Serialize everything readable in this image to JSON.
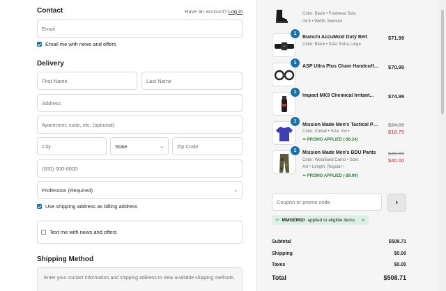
{
  "contact": {
    "heading": "Contact",
    "have_account": "Have an account?",
    "login_link": "Log in",
    "email_placeholder": "Email",
    "email_news_label": "Email me with news and offers"
  },
  "delivery": {
    "heading": "Delivery",
    "first_name_placeholder": "First Name",
    "last_name_placeholder": "Last Name",
    "address_placeholder": "Address",
    "apartment_placeholder": "Apartment, suite, etc. (optional)",
    "city_placeholder": "City",
    "state_value": "State",
    "zip_placeholder": "Zip Code",
    "phone_placeholder": "(000) 000-0000",
    "profession_value": "Profession (Required)",
    "billing_same_label": "Use shipping address as billing address",
    "text_news_label": "Text me with news and offers"
  },
  "shipping": {
    "heading": "Shipping Method",
    "note": "Enter your contact information and shipping address to view available shipping methods."
  },
  "cart": {
    "partial_item": {
      "meta1": "Color: Black • Footwear Size:",
      "meta2": "04.5 • Width: Medium"
    },
    "items": [
      {
        "qty": "1",
        "name": "Bianchi AccuMold Duty Belt",
        "meta1": "Color: Black • Size: Extra Large",
        "price": "$71.99",
        "icon": "duty-belt-image"
      },
      {
        "qty": "1",
        "name": "ASP Ultra Plus Chain Handcuffs...",
        "price": "$70.99",
        "icon": "handcuffs-image"
      },
      {
        "qty": "1",
        "name": "Impact MK9 Chemical Irritant...",
        "price": "$74.99",
        "icon": "chemical-spray-image"
      },
      {
        "qty": "1",
        "name": "Mission Made Men's Tactical Polo",
        "meta1": "Color: Cobalt • Size: Xxl •",
        "promo": "PROMO APPLIED (-$6.24)",
        "old_price": "$24.99",
        "new_price": "$18.75",
        "icon": "polo-shirt-image"
      },
      {
        "qty": "1",
        "name": "Mission Made Men's BDU Pants",
        "meta1": "Color: Woodland Camo • Size:",
        "meta2": "Xxl • Length: Regular •",
        "promo": "PROMO APPLIED (-$9.99)",
        "old_price": "$49.99",
        "new_price": "$40.00",
        "icon": "camo-pants-image"
      }
    ]
  },
  "coupon": {
    "placeholder": "Coupon or promo code",
    "applied_code": "MMGEM10",
    "applied_text": "applied to eligible items"
  },
  "summary": {
    "subtotal_label": "Subtotal",
    "subtotal_value": "$508.71",
    "shipping_label": "Shipping",
    "shipping_value": "$0.00",
    "taxes_label": "Taxes",
    "taxes_value": "$0.00",
    "total_label": "Total",
    "total_value": "$508.71"
  },
  "colors": {
    "accent": "#1773b0",
    "promo_green": "#2e8540",
    "sale_red": "#d12a2a"
  }
}
